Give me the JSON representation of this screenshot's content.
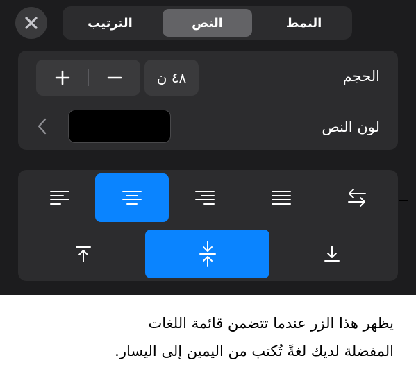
{
  "tabs": [
    {
      "label": "النمط",
      "selected": false
    },
    {
      "label": "النص",
      "selected": true
    },
    {
      "label": "الترتيب",
      "selected": false
    }
  ],
  "close": {
    "icon": "close-icon"
  },
  "size_row": {
    "label": "الحجم",
    "value": "٤٨ ن",
    "increase_icon": "plus-icon",
    "decrease_icon": "minus-icon"
  },
  "color_row": {
    "label": "لون النص",
    "swatch_color": "#000000",
    "chevron_icon": "chevron-left-icon"
  },
  "alignment": {
    "horizontal": [
      {
        "icon": "align-left-icon",
        "selected": false
      },
      {
        "icon": "align-center-icon",
        "selected": true
      },
      {
        "icon": "align-right-icon",
        "selected": false
      },
      {
        "icon": "align-justify-icon",
        "selected": false
      },
      {
        "icon": "text-direction-icon",
        "selected": false
      }
    ],
    "vertical": [
      {
        "icon": "align-top-icon",
        "selected": false
      },
      {
        "icon": "align-middle-icon",
        "selected": true
      },
      {
        "icon": "align-bottom-icon",
        "selected": false
      }
    ]
  },
  "caption": {
    "line1": "يظهر هذا الزر عندما تتضمن قائمة اللغات",
    "line2": "المفضلة لديك لغةً تُكتب من اليمين إلى اليسار."
  },
  "colors": {
    "panel": "#1c1c1e",
    "group": "#2c2c2e",
    "accent": "#0a84ff"
  }
}
